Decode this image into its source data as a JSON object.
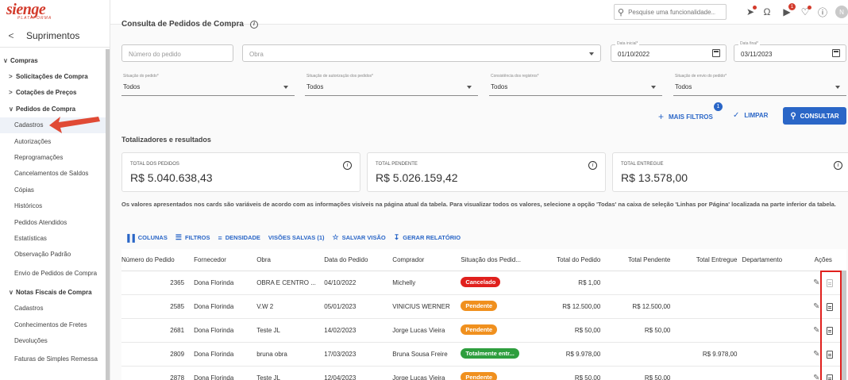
{
  "brand": {
    "name": "sienge",
    "sub": "PLATAFORMA"
  },
  "sidebar": {
    "title": "Suprimentos",
    "items": [
      {
        "label": "Compras",
        "level": 0,
        "chev": "down",
        "bold": true
      },
      {
        "label": "Solicitações de Compra",
        "level": 1,
        "chev": "right",
        "bold": true
      },
      {
        "label": "Cotações de Preços",
        "level": 1,
        "chev": "right",
        "bold": true
      },
      {
        "label": "Pedidos de Compra",
        "level": 1,
        "chev": "down",
        "bold": true
      },
      {
        "label": "Cadastros",
        "level": 2,
        "active": true
      },
      {
        "label": "Autorizações",
        "level": 2
      },
      {
        "label": "Reprogramações",
        "level": 2
      },
      {
        "label": "Cancelamentos de Saldos",
        "level": 2
      },
      {
        "label": "Cópias",
        "level": 2
      },
      {
        "label": "Históricos",
        "level": 2
      },
      {
        "label": "Pedidos Atendidos",
        "level": 2
      },
      {
        "label": "Estatísticas",
        "level": 2
      },
      {
        "label": "Observação Padrão",
        "level": 2
      },
      {
        "label": "Envio de Pedidos de Compra",
        "level": 2,
        "two": true
      },
      {
        "label": "Notas Fiscais de Compra",
        "level": 1,
        "chev": "down",
        "bold": true
      },
      {
        "label": "Cadastros",
        "level": 2
      },
      {
        "label": "Conhecimentos de Fretes",
        "level": 2
      },
      {
        "label": "Devoluções",
        "level": 2
      },
      {
        "label": "Faturas de Simples Remessa",
        "level": 2,
        "two": true
      }
    ]
  },
  "topbar": {
    "search_placeholder": "Pesquise uma funcionalidade...",
    "notification_count": "1",
    "avatar_initial": "N"
  },
  "page": {
    "title": "Consulta de Pedidos de Compra",
    "filters": {
      "order_number_placeholder": "Número do pedido",
      "obra_placeholder": "Obra",
      "date_start_label": "Data inicial*",
      "date_start_value": "01/10/2022",
      "date_end_label": "Data final*",
      "date_end_value": "03/11/2023",
      "status_label": "Situação do pedido*",
      "status_value": "Todos",
      "auth_label": "Situação de autorização dos pedidos*",
      "auth_value": "Todos",
      "consistency_label": "Consistência dos registros*",
      "consistency_value": "Todos",
      "send_label": "Situação de envio do pedido*",
      "send_value": "Todos"
    },
    "more_filters_label": "MAIS FILTROS",
    "more_filters_badge": "1",
    "clear_label": "LIMPAR",
    "consult_label": "CONSULTAR",
    "totals_title": "Totalizadores e resultados",
    "cards": [
      {
        "label": "TOTAL DOS PEDIDOS",
        "value": "R$ 5.040.638,43"
      },
      {
        "label": "TOTAL PENDENTE",
        "value": "R$ 5.026.159,42"
      },
      {
        "label": "TOTAL ENTREGUE",
        "value": "R$ 13.578,00"
      }
    ],
    "note": "Os valores apresentados nos cards são variáveis de acordo com as informações visíveis na página atual da tabela. Para visualizar todos os valores, selecione a opção 'Todas' na caixa de seleção 'Linhas por Página' localizada na parte inferior da tabela.",
    "toolbar": {
      "columns": "COLUNAS",
      "filters": "FILTROS",
      "density": "DENSIDADE",
      "saved_views": "VISÕES SALVAS (1)",
      "save_view": "SALVAR VISÃO",
      "report": "GERAR RELATÓRIO"
    },
    "table": {
      "headers": [
        "Número do Pedido",
        "Fornecedor",
        "Obra",
        "Data do Pedido",
        "Comprador",
        "Situação dos Pedid...",
        "Total do Pedido",
        "Total Pendente",
        "Total Entregue",
        "Departamento",
        "Ações"
      ],
      "rows": [
        {
          "num": "2365",
          "fornecedor": "Dona Florinda",
          "obra": "OBRA E CENTRO ...",
          "data": "04/10/2022",
          "comprador": "Michelly",
          "situacao": "Cancelado",
          "sit_color": "#e0201d",
          "total": "R$ 1,00",
          "pendente": "",
          "entregue": "",
          "depto": "",
          "faded": true
        },
        {
          "num": "2585",
          "fornecedor": "Dona Florinda",
          "obra": "V.W 2",
          "data": "05/01/2023",
          "comprador": "VINICIUS WERNER",
          "situacao": "Pendente",
          "sit_color": "#f0901e",
          "total": "R$ 12.500,00",
          "pendente": "R$ 12.500,00",
          "entregue": "",
          "depto": ""
        },
        {
          "num": "2681",
          "fornecedor": "Dona Florinda",
          "obra": "Teste JL",
          "data": "14/02/2023",
          "comprador": "Jorge Lucas Vieira",
          "situacao": "Pendente",
          "sit_color": "#f0901e",
          "total": "R$ 50,00",
          "pendente": "R$ 50,00",
          "entregue": "",
          "depto": ""
        },
        {
          "num": "2809",
          "fornecedor": "Dona Florinda",
          "obra": "bruna obra",
          "data": "17/03/2023",
          "comprador": "Bruna Sousa Freire",
          "situacao": "Totalmente entr...",
          "sit_color": "#2e9e3e",
          "total": "R$ 9.978,00",
          "pendente": "",
          "entregue": "R$ 9.978,00",
          "depto": ""
        },
        {
          "num": "2878",
          "fornecedor": "Dona Florinda",
          "obra": "Teste JL",
          "data": "12/04/2023",
          "comprador": "Jorge Lucas Vieira",
          "situacao": "Pendente",
          "sit_color": "#f0901e",
          "total": "R$ 50,00",
          "pendente": "R$ 50,00",
          "entregue": "",
          "depto": ""
        }
      ]
    }
  }
}
